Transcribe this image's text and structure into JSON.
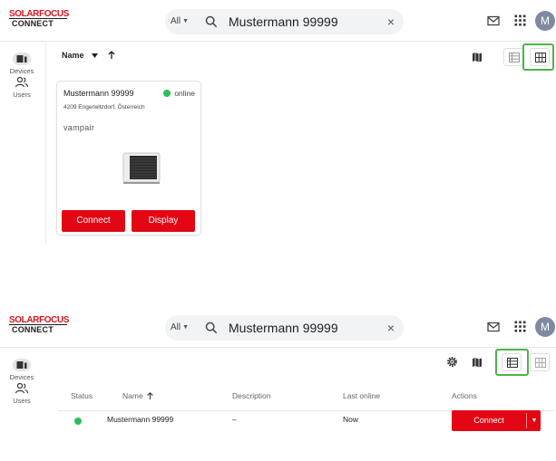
{
  "brand": {
    "line1": "SOLARFOCUS",
    "line2": "CONNECT"
  },
  "search": {
    "scope": "All",
    "query": "Mustermann 99999",
    "clear_glyph": "×"
  },
  "header": {
    "avatar_initial": "M"
  },
  "nav": {
    "items": [
      {
        "label": "Devices",
        "icon": "devices-icon"
      },
      {
        "label": "Users",
        "icon": "users-icon"
      }
    ]
  },
  "colors": {
    "accent_red": "#e30613",
    "online_green": "#2ebd59",
    "highlight_green": "#4cb34a"
  },
  "card_view": {
    "sort_label": "Name",
    "device": {
      "name": "Mustermann 99999",
      "status": "online",
      "address": "4209 Engerwitzdorf, Österreich",
      "product": "vampair",
      "connect_label": "Connect",
      "display_label": "Display"
    }
  },
  "list_view": {
    "columns": {
      "status": "Status",
      "name": "Name",
      "description": "Description",
      "last_online": "Last online",
      "actions": "Actions"
    },
    "rows": [
      {
        "name": "Mustermann 99999",
        "description": "–",
        "last_online": "Now",
        "action_label": "Connect"
      }
    ]
  }
}
